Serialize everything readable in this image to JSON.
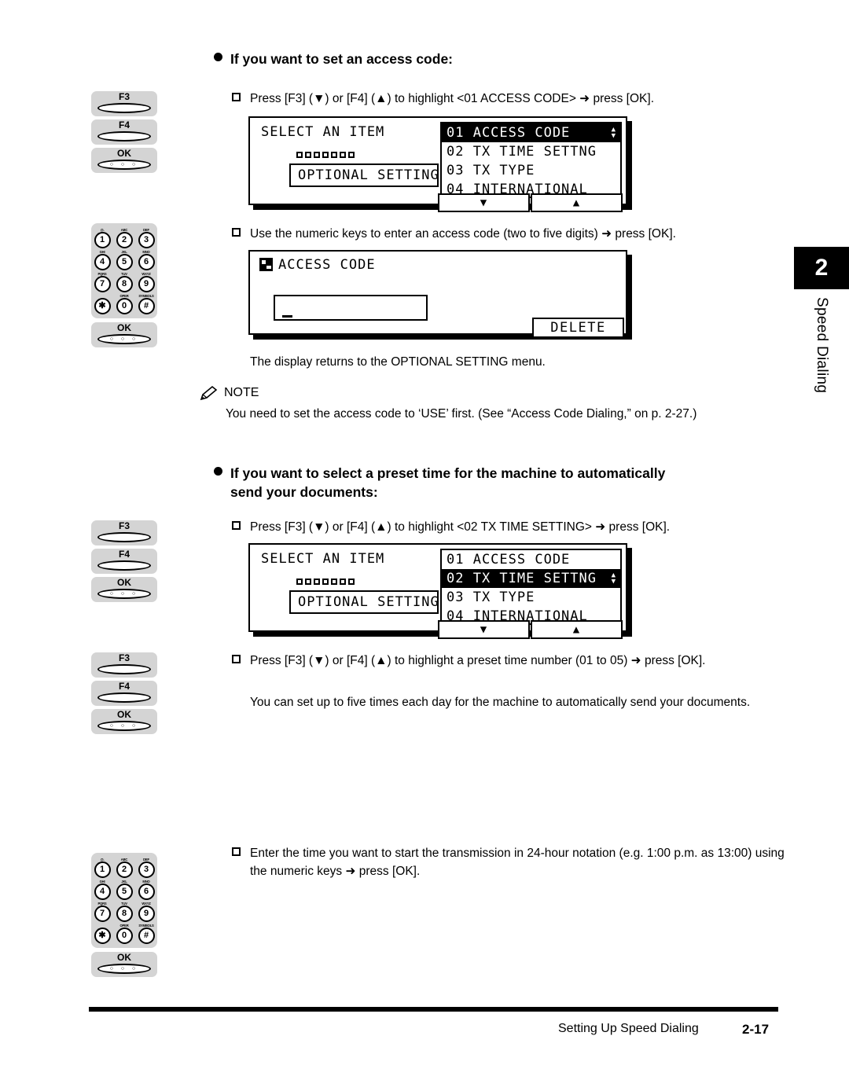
{
  "chapter": {
    "number": "2",
    "name": "Speed Dialing"
  },
  "sections": [
    {
      "heading": "If you want to set an access code:",
      "step1": "Press [F3] (▼) or [F4] (▲) to highlight <01 ACCESS CODE> ➜ press [OK].",
      "step2": "Use the numeric keys to enter an access code (two to five digits) ➜ press [OK].",
      "after_text": "The display returns to the OPTIONAL SETTING menu."
    },
    {
      "heading_line1": "If you want to select a preset time for the machine to automatically",
      "heading_line2": "send your documents:",
      "step1": "Press [F3] (▼) or [F4] (▲) to highlight <02 TX TIME SETTING> ➜ press [OK].",
      "step2": "Press [F3] (▼) or [F4] (▲) to highlight a preset time number (01 to 05) ➜ press [OK].",
      "step2_body": "You can set up to five times each day for the machine to automatically send your documents.",
      "step3": "Enter the time you want to start the transmission in 24-hour notation (e.g. 1:00 p.m. as 13:00) using the numeric keys ➜ press [OK]."
    }
  ],
  "note": {
    "label": "NOTE",
    "body": "You need to set the access code to ‘USE’ first. (See “Access Code Dialing,” on p. 2-27.)"
  },
  "keys": {
    "f3": "F3",
    "f4": "F4",
    "ok": "OK",
    "ok_dots": "○ ○ ○"
  },
  "keypad": {
    "rows": [
      [
        {
          "sub": "@.",
          "num": "1"
        },
        {
          "sub": "ABC",
          "num": "2"
        },
        {
          "sub": "DEF",
          "num": "3"
        }
      ],
      [
        {
          "sub": "GHI",
          "num": "4"
        },
        {
          "sub": "JKL",
          "num": "5"
        },
        {
          "sub": "MNO",
          "num": "6"
        }
      ],
      [
        {
          "sub": "PQRS",
          "num": "7"
        },
        {
          "sub": "TUV",
          "num": "8"
        },
        {
          "sub": "WXYZ",
          "num": "9"
        }
      ],
      [
        {
          "sub": "",
          "num": "✱"
        },
        {
          "sub": "OPER",
          "num": "0"
        },
        {
          "sub": "SYMBOLS",
          "num": "#"
        }
      ]
    ]
  },
  "lcd1": {
    "title": "SELECT AN ITEM",
    "field": "OPTIONAL SETTING",
    "menu": [
      {
        "text": "01 ACCESS CODE",
        "selected": true
      },
      {
        "text": "02 TX TIME SETTNG",
        "selected": false
      },
      {
        "text": "03 TX TYPE",
        "selected": false
      },
      {
        "text": "04 INTERNATIONAL",
        "selected": false
      }
    ],
    "soft_down": "▼",
    "soft_up": "▲"
  },
  "lcd2": {
    "title": "ACCESS CODE",
    "input_value": "",
    "delete_label": "DELETE"
  },
  "lcd3": {
    "title": "SELECT AN ITEM",
    "field": "OPTIONAL SETTING",
    "menu": [
      {
        "text": "01 ACCESS CODE",
        "selected": false
      },
      {
        "text": "02 TX TIME SETTNG",
        "selected": true
      },
      {
        "text": "03 TX TYPE",
        "selected": false
      },
      {
        "text": "04 INTERNATIONAL",
        "selected": false
      }
    ],
    "soft_down": "▼",
    "soft_up": "▲"
  },
  "footer": {
    "title": "Setting Up Speed Dialing",
    "page": "2-17"
  }
}
